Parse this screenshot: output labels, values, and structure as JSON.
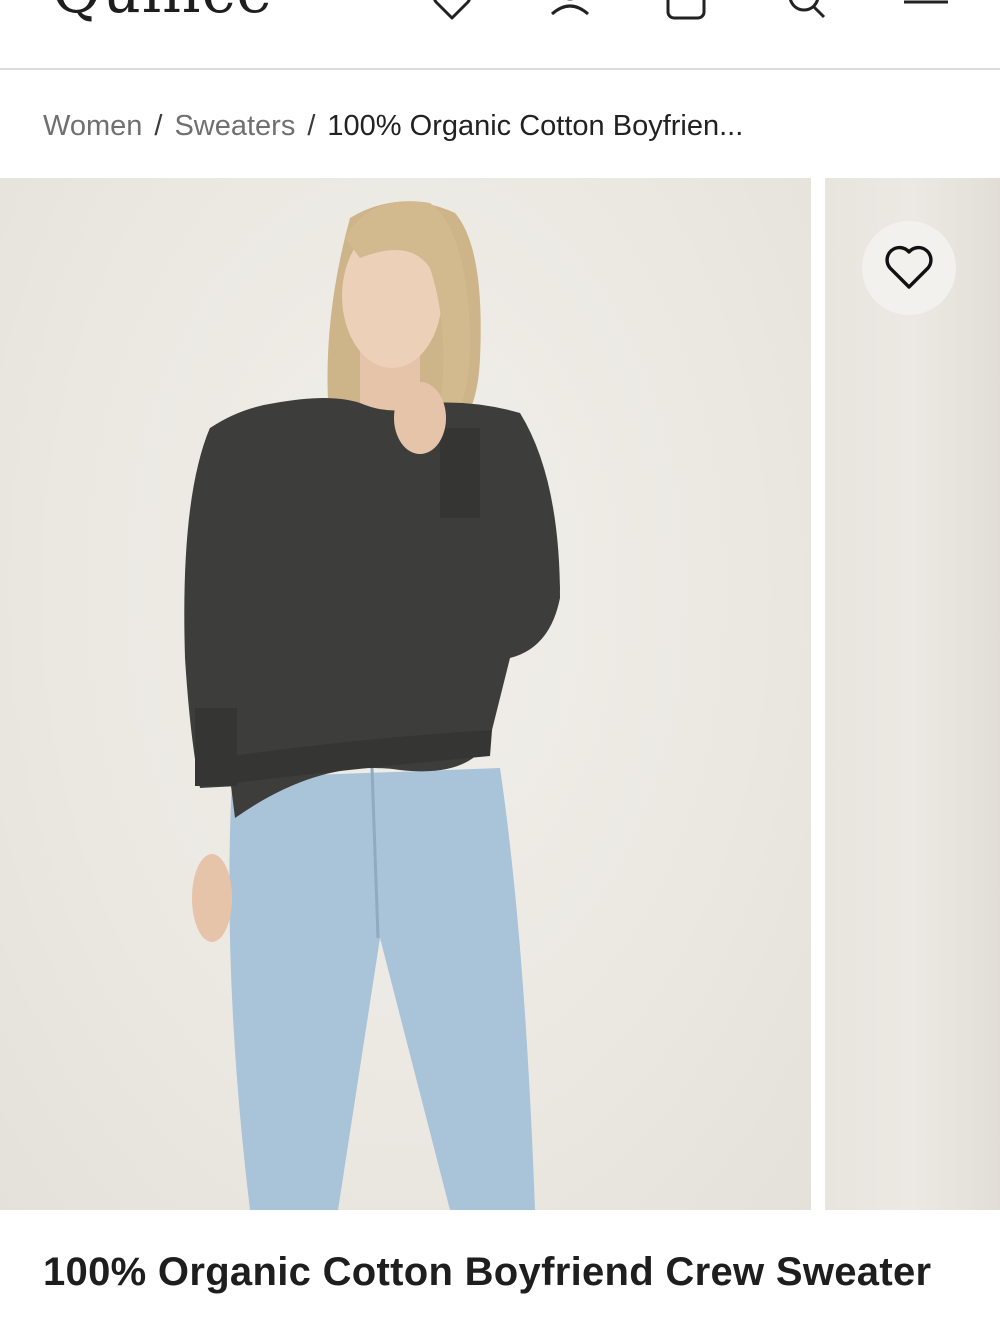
{
  "header": {
    "logo": "Quince",
    "icons": [
      "heart-icon",
      "account-icon",
      "bag-icon",
      "search-icon",
      "menu-icon"
    ]
  },
  "breadcrumb": {
    "items": [
      "Women",
      "Sweaters"
    ],
    "separator": "/",
    "current": "100% Organic Cotton Boyfrien..."
  },
  "gallery": {
    "favorite_icon": "heart-icon",
    "sweater_color": "#3d3e3c",
    "jeans_color": "#a9c3d8"
  },
  "product": {
    "title": "100% Organic Cotton Boyfriend Crew Sweater"
  }
}
